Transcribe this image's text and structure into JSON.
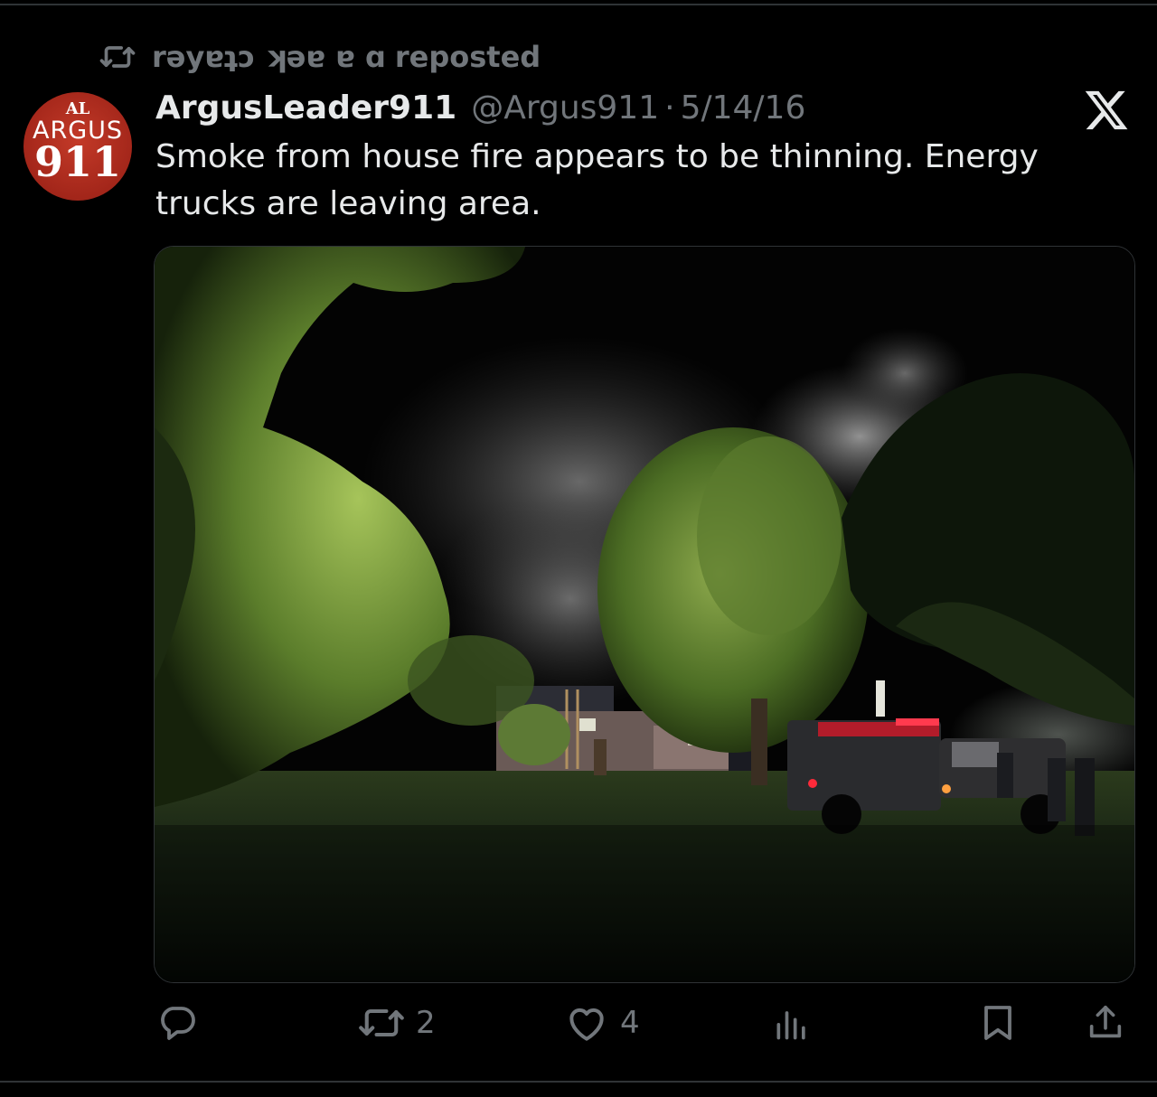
{
  "repost_banner": {
    "icon": "repost-icon",
    "reposter": "rəyɐʇɔ ʞəɐ ɐ ɑ",
    "label": "reposted"
  },
  "tweet": {
    "avatar": {
      "line1": "AL",
      "line2": "ARGUS",
      "line3": "911"
    },
    "display_name": "ArgusLeader911",
    "handle": "@Argus911",
    "separator": "·",
    "date": "5/14/16",
    "text": "Smoke from house fire appears to be thinning. Energy trucks are leaving area.",
    "platform_icon": "x-logo-icon",
    "media_icon": "photo-night-house-fire"
  },
  "actions": {
    "reply": {
      "icon": "reply-icon",
      "count": ""
    },
    "repost": {
      "icon": "repost-icon",
      "count": "2"
    },
    "like": {
      "icon": "heart-icon",
      "count": "4"
    },
    "views": {
      "icon": "views-icon",
      "count": ""
    },
    "bookmark": {
      "icon": "bookmark-icon"
    },
    "share": {
      "icon": "share-icon"
    }
  },
  "colors": {
    "background": "#000000",
    "primary_text": "#e7e9ea",
    "secondary_text": "#71767b",
    "avatar_red": "#a3261a"
  }
}
